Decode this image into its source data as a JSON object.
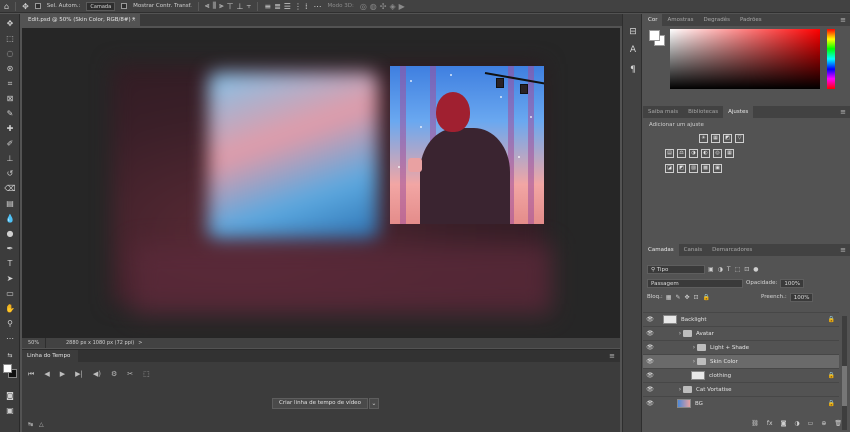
{
  "options_bar": {
    "auto_select_label": "Sel. Autom.:",
    "auto_select_value": "Camada",
    "show_transform_label": "Mostrar Contr. Transf.",
    "mode_3d_label": "Modo 3D:"
  },
  "document": {
    "tab_title": "Edit.psd @ 50% (Skin Color, RGB/8#) *",
    "close_glyph": "×"
  },
  "status_bar": {
    "zoom": "50%",
    "info": "2880 px x 1080 px (72 ppi)",
    "chevron": ">"
  },
  "timeline": {
    "tab_label": "Linha do Tempo",
    "create_button": "Criar linha de tempo de vídeo",
    "dropdown_glyph": "⌄",
    "controls": [
      "⏮",
      "◀",
      "▶",
      "▶|",
      "◀)",
      "⚙",
      "✂",
      "⬚"
    ]
  },
  "color_panel": {
    "tabs": [
      "Cor",
      "Amostras",
      "Degradês",
      "Padrões"
    ],
    "foreground": "#ffffff",
    "background": "#ffffff"
  },
  "adjust_panel": {
    "tabs": [
      "Saiba mais",
      "Bibliotecas",
      "Ajustes"
    ],
    "add_label": "Adicionar um ajuste",
    "row1": [
      "☀",
      "▦",
      "◩",
      "▽"
    ],
    "row2": [
      "▤",
      "⚖",
      "◑",
      "◐",
      "◎",
      "▦"
    ],
    "row3": [
      "◪",
      "◩",
      "▨",
      "▩",
      "▣"
    ]
  },
  "layers_panel": {
    "tabs": [
      "Camadas",
      "Canais",
      "Demarcadores"
    ],
    "filter_label": "Tipo",
    "blend_mode": "Passagem",
    "opacity_label": "Opacidade:",
    "opacity_value": "100%",
    "lock_label": "Bloq.:",
    "fill_label": "Preench.:",
    "fill_value": "100%",
    "layers": [
      {
        "name": "Backlight",
        "kind": "layer",
        "indent": 0,
        "locked": true,
        "selected": false
      },
      {
        "name": "Avatar",
        "kind": "folder",
        "indent": 1,
        "locked": false,
        "selected": false
      },
      {
        "name": "Light + Shade",
        "kind": "folder",
        "indent": 2,
        "locked": false,
        "selected": false
      },
      {
        "name": "Skin Color",
        "kind": "folder",
        "indent": 2,
        "locked": false,
        "selected": true
      },
      {
        "name": "clothing",
        "kind": "layer",
        "indent": 2,
        "locked": true,
        "selected": false
      },
      {
        "name": "Cat Vortatise",
        "kind": "folder",
        "indent": 1,
        "locked": false,
        "selected": false
      },
      {
        "name": "BG",
        "kind": "image",
        "indent": 1,
        "locked": true,
        "selected": false
      }
    ]
  }
}
